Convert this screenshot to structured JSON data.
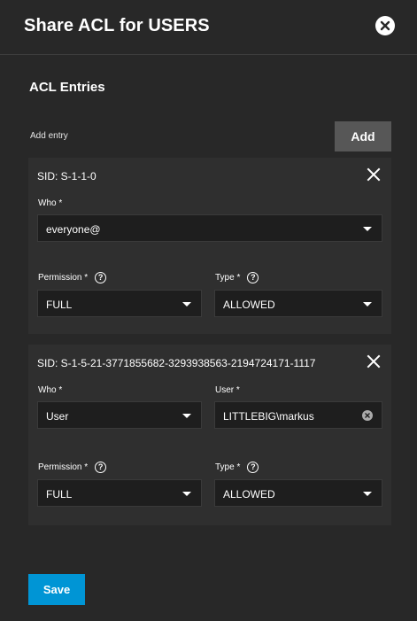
{
  "dialog": {
    "title": "Share ACL for USERS",
    "section_title": "ACL Entries",
    "add_entry_label": "Add entry",
    "add_button": "Add",
    "save_button": "Save"
  },
  "entries": [
    {
      "sid": "SID: S-1-1-0",
      "who_label": "Who *",
      "who_value": "everyone@",
      "permission_label": "Permission *",
      "permission_value": "FULL",
      "type_label": "Type *",
      "type_value": "ALLOWED"
    },
    {
      "sid": "SID: S-1-5-21-3771855682-3293938563-2194724171-1117",
      "who_label": "Who *",
      "who_value": "User",
      "user_label": "User *",
      "user_value": "LITTLEBIG\\markus",
      "permission_label": "Permission *",
      "permission_value": "FULL",
      "type_label": "Type *",
      "type_value": "ALLOWED"
    }
  ],
  "help_glyph": "?",
  "icons": [
    "close-circle-icon",
    "remove-entry-icon",
    "help-icon",
    "chevron-down-icon",
    "clear-input-icon"
  ]
}
